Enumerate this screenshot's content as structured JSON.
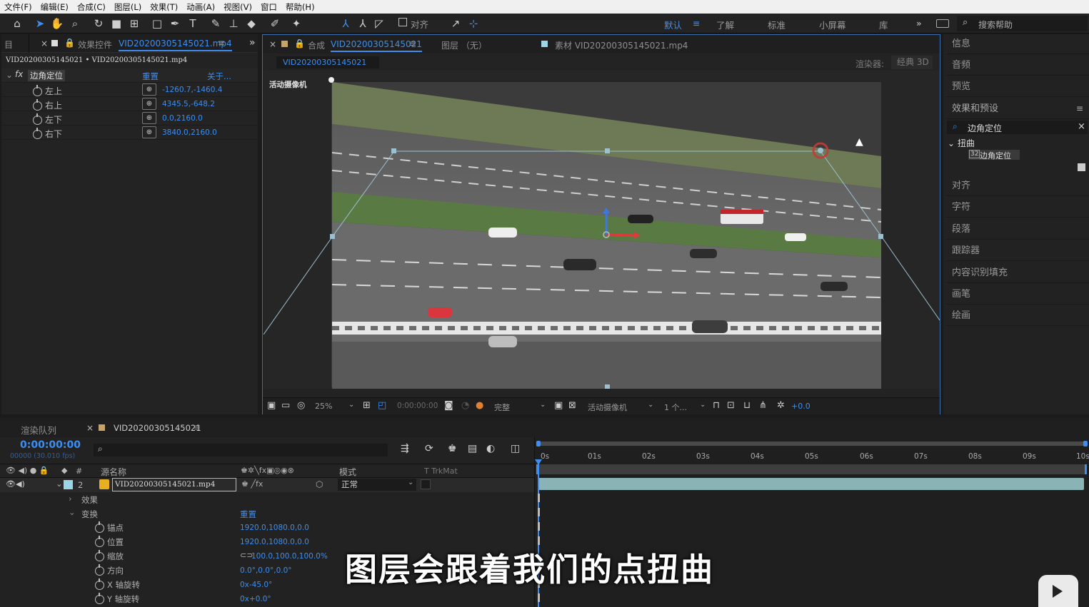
{
  "menu": [
    "文件(F)",
    "编辑(E)",
    "合成(C)",
    "图层(L)",
    "效果(T)",
    "动画(A)",
    "视图(V)",
    "窗口",
    "帮助(H)"
  ],
  "toolbar": {
    "align_label": "对齐",
    "workspaces": [
      "默认",
      "了解",
      "标准",
      "小屏幕",
      "库"
    ],
    "search_help": "搜索帮助"
  },
  "effects_panel": {
    "left_tab": "目",
    "tab_title": "效果控件",
    "tab_file": "VID20200305145021.mp4",
    "breadcrumb": "VID20200305145021 • VID20200305145021.mp4",
    "effect_name": "边角定位",
    "reset": "重置",
    "about": "关于...",
    "props": [
      {
        "name": "左上",
        "value": "-1260.7,-1460.4"
      },
      {
        "name": "右上",
        "value": "4345.5,-648.2"
      },
      {
        "name": "左下",
        "value": "0.0,2160.0"
      },
      {
        "name": "右下",
        "value": "3840.0,2160.0"
      }
    ]
  },
  "comp_panel": {
    "tab_label": "合成",
    "tab_name": "VID20200305145021",
    "layer_tab": "图层 （无）",
    "footage_tab": "素材 VID20200305145021.mp4",
    "comp_chip": "VID20200305145021",
    "renderer_label": "渲染器:",
    "renderer_value": "经典 3D",
    "camera_label": "活动摄像机",
    "bottom": {
      "zoom": "25%",
      "timecode": "0:00:00:00",
      "quality": "完整",
      "view": "活动摄像机",
      "views": "1 个...",
      "exposure": "+0.0"
    }
  },
  "right_panel": {
    "items_top": [
      "信息",
      "音频",
      "预览"
    ],
    "effects_presets": "效果和预设",
    "search_value": "边角定位",
    "category": "扭曲",
    "result": "边角定位",
    "items_bottom": [
      "对齐",
      "字符",
      "段落",
      "跟踪器",
      "内容识别填充",
      "画笔",
      "绘画"
    ]
  },
  "timeline": {
    "render_queue": "渲染队列",
    "comp_tab": "VID20200305145021",
    "timecode": "0:00:00:00",
    "fps": "00000 (30.010 fps)",
    "col_source": "源名称",
    "col_mode": "模式",
    "col_trkmat": "T  TrkMat",
    "layer_num": "2",
    "layer_name": "VID20200305145021.mp4",
    "layer_mode": "正常",
    "effects_label": "效果",
    "transform_label": "变换",
    "transform_reset": "重置",
    "props": [
      {
        "name": "锚点",
        "value": "1920.0,1080.0,0.0"
      },
      {
        "name": "位置",
        "value": "1920.0,1080.0,0.0"
      },
      {
        "name": "缩放",
        "value": "100.0,100.0,100.0%"
      },
      {
        "name": "方向",
        "value": "0.0°,0.0°,0.0°"
      },
      {
        "name": "X 轴旋转",
        "value": "0x-45.0°"
      },
      {
        "name": "Y 轴旋转",
        "value": "0x+0.0°"
      }
    ],
    "ruler": [
      "0s",
      "01s",
      "02s",
      "03s",
      "04s",
      "05s",
      "06s",
      "07s",
      "08s",
      "09s",
      "10s"
    ]
  },
  "subtitle": "图层会跟着我们的点扭曲",
  "colors": {
    "accent": "#3d8ef0",
    "bg": "#1b1b1b",
    "panel": "#232323"
  }
}
